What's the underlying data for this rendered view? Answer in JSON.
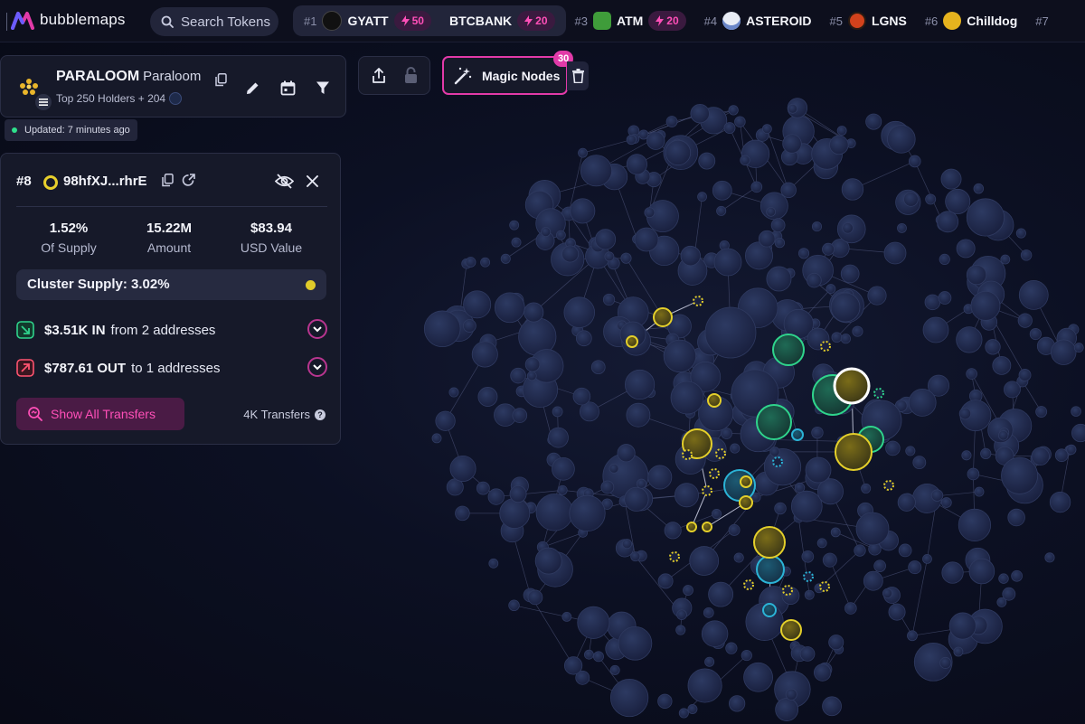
{
  "app": {
    "logo_text": "bubblemaps",
    "search_placeholder": "Search Tokens"
  },
  "ticker": [
    {
      "rank": "#1",
      "symbol": "GYATT",
      "boost": "50",
      "icon_color": "#111111"
    },
    {
      "rank": "",
      "symbol": "BTCBANK",
      "boost": "20",
      "icon_color": ""
    },
    {
      "rank": "#3",
      "symbol": "ATM",
      "boost": "20",
      "icon_color": "#3f9c3a"
    },
    {
      "rank": "#4",
      "symbol": "ASTEROID",
      "boost": "",
      "icon_color": "#e8ecf5"
    },
    {
      "rank": "#5",
      "symbol": "LGNS",
      "boost": "",
      "icon_color": "#d2421c"
    },
    {
      "rank": "#6",
      "symbol": "Chilldog",
      "boost": "",
      "icon_color": "#e6b31e"
    },
    {
      "rank": "#7",
      "symbol": "",
      "boost": "",
      "icon_color": ""
    }
  ],
  "token": {
    "symbol": "PARALOOM",
    "name": "Paraloom",
    "holders_label": "Top 250 Holders + 204",
    "updated": "Updated: 7 minutes ago"
  },
  "toolbar": {
    "magic_nodes_label": "Magic Nodes",
    "magic_nodes_count": "30"
  },
  "wallet": {
    "rank": "#8",
    "address": "98hfXJ...rhrE",
    "stats": [
      {
        "value": "1.52%",
        "label": "Of Supply"
      },
      {
        "value": "15.22M",
        "label": "Amount"
      },
      {
        "value": "$83.94",
        "label": "USD Value"
      }
    ],
    "cluster_supply": "Cluster Supply: 3.02%",
    "flow_in": {
      "amount": "$3.51K IN",
      "desc": "from 2 addresses"
    },
    "flow_out": {
      "amount": "$787.61 OUT",
      "desc": "to 1 addresses"
    },
    "show_transfers_label": "Show All Transfers",
    "transfers_count": "4K Transfers"
  },
  "colors": {
    "accent_pink": "#e23aa8",
    "cluster_yellow": "#e0cb2a",
    "cluster_green": "#2fd48c",
    "cluster_cyan": "#2bb3d6",
    "bubble_default": "#1f2845"
  }
}
